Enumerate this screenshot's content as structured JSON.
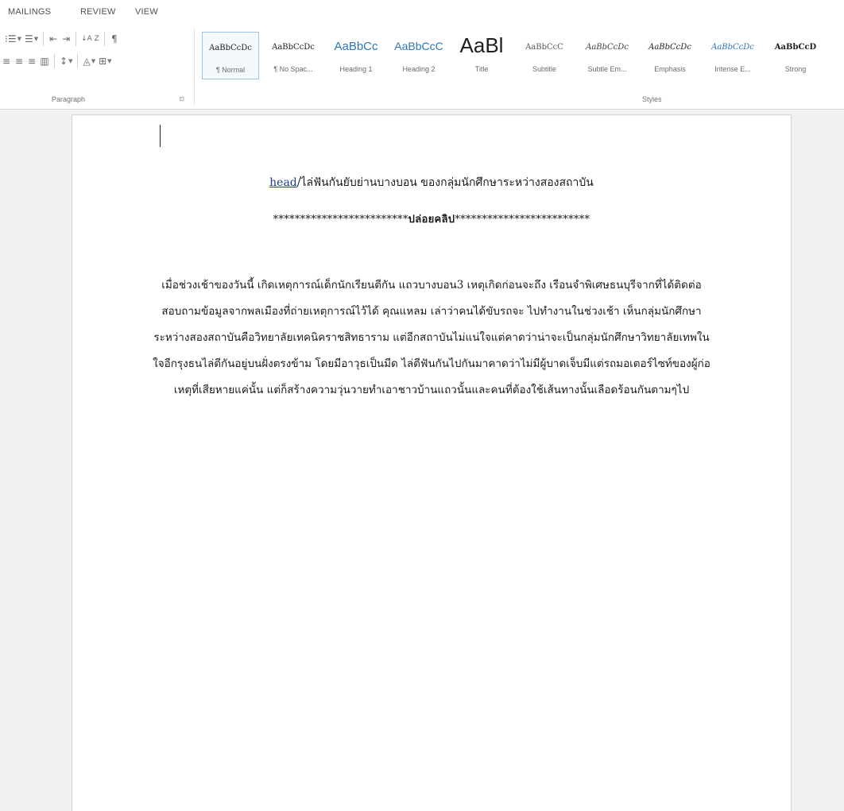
{
  "ribbon_tabs": [
    "MAILINGS",
    "REVIEW",
    "VIEW"
  ],
  "paragraph_group": {
    "label": "Paragraph",
    "launcher": "⊡",
    "row1": [
      "⁝☰",
      "☰",
      "⇤",
      "⇥",
      "↓A Z",
      "¶"
    ],
    "row2": [
      "≡",
      "≡",
      "≡",
      "▥",
      "↕",
      "◬",
      "⊞"
    ]
  },
  "styles_group": {
    "label": "Styles",
    "items": [
      {
        "sample": "AaBbCcDc",
        "name": "¶ Normal",
        "color": "#1e1e1e",
        "selected": true
      },
      {
        "sample": "AaBbCcDc",
        "name": "¶ No Spac...",
        "color": "#1e1e1e",
        "selected": false
      },
      {
        "sample": "AaBbCc",
        "name": "Heading 1",
        "color": "#2e74b5",
        "selected": false
      },
      {
        "sample": "AaBbCcC",
        "name": "Heading 2",
        "color": "#2e74b5",
        "selected": false
      },
      {
        "sample": "AaBl",
        "name": "Title",
        "color": "#1e1e1e",
        "selected": false
      },
      {
        "sample": "AaBbCcC",
        "name": "Subtitle",
        "color": "#595959",
        "selected": false
      },
      {
        "sample": "AaBbCcDc",
        "name": "Subtle Em...",
        "color": "#404040",
        "selected": false
      },
      {
        "sample": "AaBbCcDc",
        "name": "Emphasis",
        "color": "#1e1e1e",
        "selected": false
      },
      {
        "sample": "AaBbCcDc",
        "name": "Intense E...",
        "color": "#2e74b5",
        "selected": false
      },
      {
        "sample": "AaBbCcD",
        "name": "Strong",
        "color": "#1e1e1e",
        "selected": false
      }
    ]
  },
  "document": {
    "heading_link": "head",
    "heading_rest": "/ไล่ฟันกันยับย่านบางบอน ของกลุ่มนักศึกษาระหว่างสองสถาบัน",
    "clip_stars_left": "*************************",
    "clip_label": "ปล่อยคลิป",
    "clip_stars_right": "*************************",
    "body": "เมื่อช่วงเช้าของวันนี้ เกิดเหตุการณ์เด็กนักเรียนตีกัน แถวบางบอน3 เหตุเกิดก่อนจะถึง เรือนจำพิเศษธนบุรีจากที่ได้ติดต่อสอบถามข้อมูลจากพลเมืองที่ถ่ายเหตุการณ์ไว้ได้ คุณแหลม เล่าว่าคนได้ขับรถจะ ไปทำงานในช่วงเช้า เห็นกลุ่มนักศึกษาระหว่างสองสถาบันคือวิทยาลัยเทคนิคราชสิทธาราม แต่อีกสถาบันไม่แน่ใจแต่คาดว่าน่าจะเป็นกลุ่มนักศึกษาวิทยาลัยเทพในใจอีกรุงธนไล่ตีกันอยู่บนฝั่งตรงข้าม โดยมีอาวุธเป็นมีด ไล่ตีฟันกันไปกันมาคาดว่าไม่มีผู้บาดเจ็บมีแต่รถมอเตอร์ไซท์ของผู้ก่อเหตุที่เสียหายแค่นั้น แต่ก็สร้างความวุ่นวายทำเอาชาวบ้านแถวนั้นและคนที่ต้องใช้เส้นทางนั้นเลือดร้อนกันตามๆไป"
  }
}
